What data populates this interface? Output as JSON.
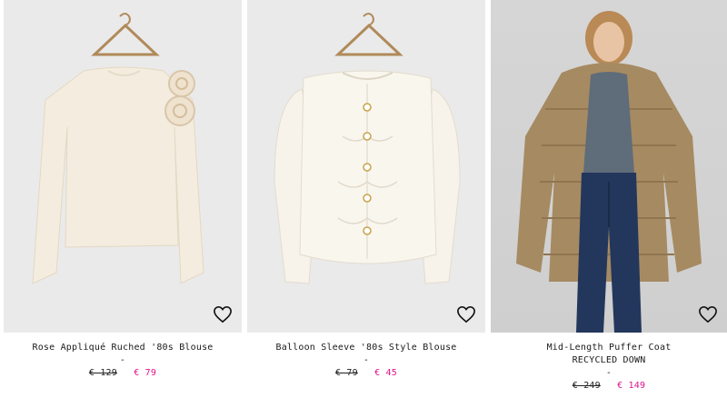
{
  "products": [
    {
      "name": "Rose Appliqué Ruched '80s Blouse",
      "subtitle": "",
      "separator": "-",
      "old_price": "€ 129",
      "new_price": "€ 79",
      "image_icon": "rose-blouse-image"
    },
    {
      "name": "Balloon Sleeve '80s Style Blouse",
      "subtitle": "",
      "separator": "-",
      "old_price": "€ 79",
      "new_price": "€ 45",
      "image_icon": "balloon-blouse-image"
    },
    {
      "name": "Mid-Length Puffer Coat",
      "subtitle": "RECYCLED DOWN",
      "separator": "-",
      "old_price": "€ 249",
      "new_price": "€ 149",
      "image_icon": "puffer-coat-image"
    }
  ],
  "colors": {
    "sale_price": "#e0138c",
    "card_bg": "#eaeaea"
  },
  "icons": {
    "wishlist": "heart-icon"
  }
}
